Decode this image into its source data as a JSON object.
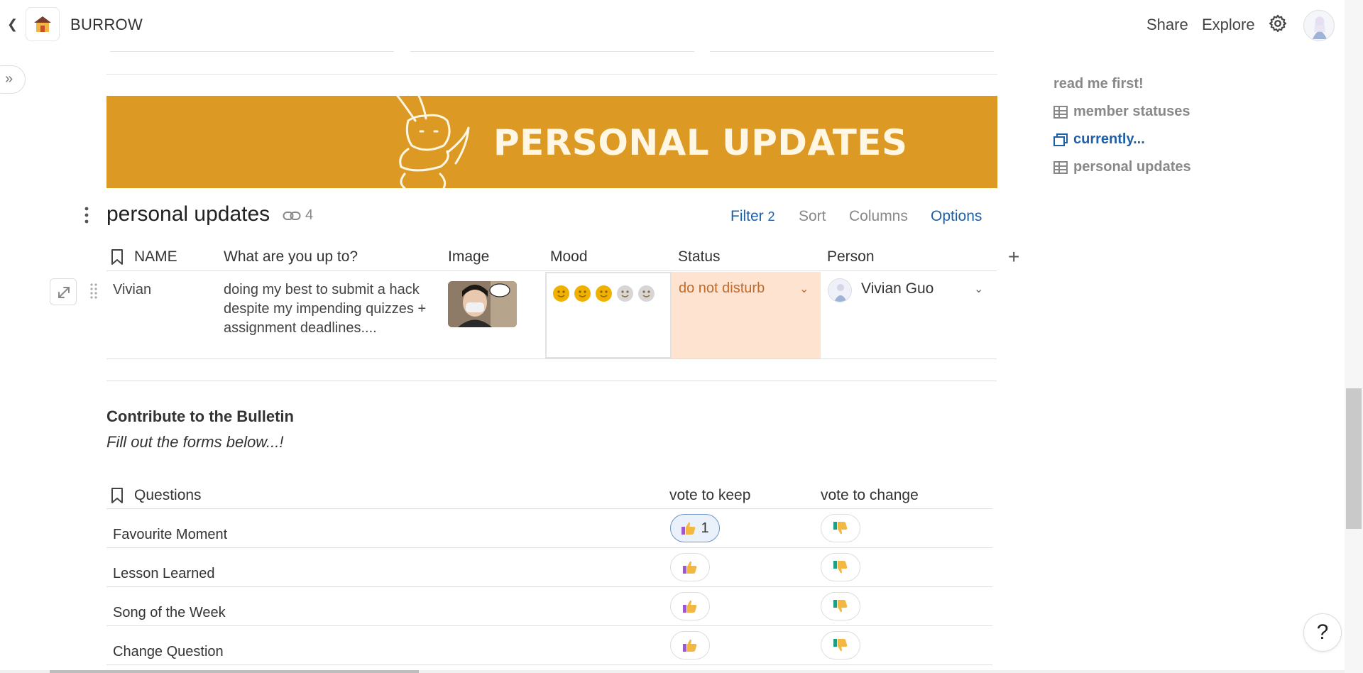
{
  "header": {
    "workspace_name": "BURROW",
    "share_label": "Share",
    "explore_label": "Explore"
  },
  "banner": {
    "title": "PERSONAL UPDATES"
  },
  "table": {
    "title": "personal updates",
    "link_count": "4",
    "filter_label": "Filter",
    "filter_count": "2",
    "sort_label": "Sort",
    "columns_label": "Columns",
    "options_label": "Options",
    "columns": [
      "NAME",
      "What are you up to?",
      "Image",
      "Mood",
      "Status",
      "Person"
    ],
    "row": {
      "name": "Vivian",
      "up_to": "doing my best to submit a hack despite my impending quizzes + assignment deadlines....",
      "mood_rating": 3,
      "mood_max": 5,
      "status": "do not disturb",
      "person": "Vivian Guo"
    }
  },
  "bulletin": {
    "title": "Contribute to the Bulletin",
    "subtitle": "Fill out the forms below...!",
    "columns": [
      "Questions",
      "vote to keep",
      "vote to change"
    ],
    "rows": [
      {
        "question": "Favourite Moment",
        "keep_count": "1"
      },
      {
        "question": "Lesson Learned",
        "keep_count": ""
      },
      {
        "question": "Song of the Week",
        "keep_count": ""
      },
      {
        "question": "Change Question",
        "keep_count": ""
      }
    ]
  },
  "outline": {
    "items": [
      {
        "label": "read me first!",
        "icon": "none"
      },
      {
        "label": "member statuses",
        "icon": "table-icon"
      },
      {
        "label": "currently...",
        "icon": "window-icon"
      },
      {
        "label": "personal updates",
        "icon": "table-icon"
      }
    ]
  },
  "colors": {
    "banner": "#dc9a25",
    "accent_blue": "#1f5fa8",
    "status_bg": "#fde3d0",
    "status_text": "#c06a2c",
    "mood_on": "#f0b000",
    "mood_off": "#d6d6d6"
  }
}
